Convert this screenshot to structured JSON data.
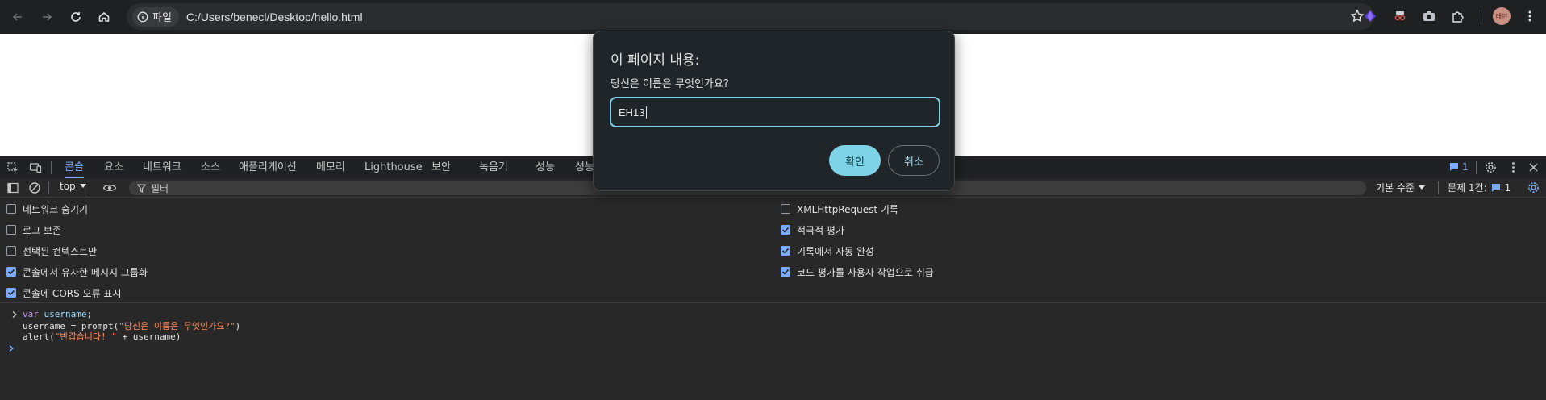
{
  "toolbar": {
    "site_chip_label": "파일",
    "url": "C:/Users/benecl/Desktop/hello.html",
    "avatar_text": "태민"
  },
  "dialog": {
    "title": "이 페이지 내용:",
    "message": "당신은 이름은 무엇인가요?",
    "input_value": "EH13",
    "ok_label": "확인",
    "cancel_label": "취소"
  },
  "devtools": {
    "tabs": [
      "콘솔",
      "요소",
      "네트워크",
      "소스",
      "애플리케이션",
      "메모리",
      "Lighthouse",
      "보안",
      "녹음기",
      "성능",
      "성능"
    ],
    "active_tab": "콘솔",
    "issue_badge_count": "1",
    "context_label": "top",
    "filter_placeholder": "필터",
    "levels_label": "기본 수준",
    "issues_label": "문제 1건:",
    "issues_count": "1",
    "options_left": [
      {
        "label": "네트워크 숨기기",
        "checked": false
      },
      {
        "label": "로그 보존",
        "checked": false
      },
      {
        "label": "선택된 컨텍스트만",
        "checked": false
      },
      {
        "label": "콘솔에서 유사한 메시지 그룹화",
        "checked": true
      },
      {
        "label": "콘솔에 CORS 오류 표시",
        "checked": true
      }
    ],
    "options_right": [
      {
        "label": "XMLHttpRequest 기록",
        "checked": false
      },
      {
        "label": "적극적 평가",
        "checked": true
      },
      {
        "label": "기록에서 자동 완성",
        "checked": true
      },
      {
        "label": "코드 평가를 사용자 작업으로 취급",
        "checked": true
      }
    ],
    "code": {
      "line1_kw": "var",
      "line1_var": " username",
      "line1_end": ";",
      "line2_pre": "username = prompt(",
      "line2_str": "\"당신은 이름은 무엇인가요?\"",
      "line2_end": ")",
      "line3_pre": "alert(",
      "line3_str": "\"반갑습니다! \"",
      "line3_end": " + username)"
    }
  },
  "colors": {
    "accent": "#7fd3e6",
    "devtools_tab_active": "#7cacf8"
  }
}
